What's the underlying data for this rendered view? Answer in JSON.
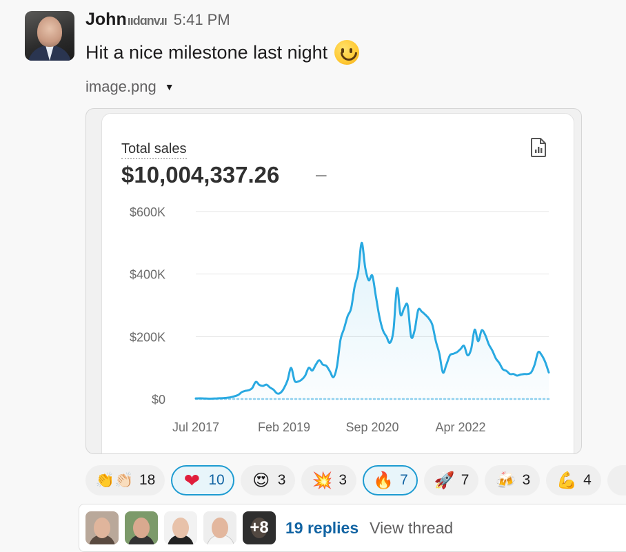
{
  "message": {
    "author": "John",
    "author_obscured": "ııdɑnvɹı",
    "time": "5:41 PM",
    "text": "Hit a nice milestone last night",
    "attachment": {
      "filename": "image.png",
      "caret": "▼"
    }
  },
  "card": {
    "title": "Total sales",
    "value": "$10,004,337.26",
    "dash": "–",
    "icon": "report-icon"
  },
  "chart_data": {
    "type": "area",
    "title": "Total sales",
    "ylim": [
      0,
      600000
    ],
    "yticks": [
      {
        "value": 0,
        "label": "$0"
      },
      {
        "value": 200000,
        "label": "$200K"
      },
      {
        "value": 400000,
        "label": "$400K"
      },
      {
        "value": 600000,
        "label": "$600K"
      }
    ],
    "xlim": [
      0,
      100
    ],
    "xticks": [
      {
        "x": 0,
        "label": "Jul 2017"
      },
      {
        "x": 25,
        "label": "Feb 2019"
      },
      {
        "x": 50,
        "label": "Sep 2020"
      },
      {
        "x": 75,
        "label": "Apr 2022"
      }
    ],
    "line_color": "#29a9e1",
    "comparison_line": "dotted at $0",
    "series": [
      {
        "points": [
          [
            0,
            2000
          ],
          [
            2,
            2000
          ],
          [
            4,
            1000
          ],
          [
            6,
            2000
          ],
          [
            8,
            3000
          ],
          [
            10,
            6000
          ],
          [
            12,
            13000
          ],
          [
            13,
            22000
          ],
          [
            14,
            26000
          ],
          [
            15,
            28000
          ],
          [
            16,
            35000
          ],
          [
            17,
            55000
          ],
          [
            18,
            45000
          ],
          [
            19,
            42000
          ],
          [
            20,
            46000
          ],
          [
            21,
            37000
          ],
          [
            22,
            30000
          ],
          [
            23,
            18000
          ],
          [
            24,
            20000
          ],
          [
            25,
            35000
          ],
          [
            26,
            60000
          ],
          [
            27,
            100000
          ],
          [
            28,
            58000
          ],
          [
            29,
            56000
          ],
          [
            30,
            62000
          ],
          [
            31,
            75000
          ],
          [
            32,
            100000
          ],
          [
            33,
            91000
          ],
          [
            34,
            110000
          ],
          [
            35,
            124000
          ],
          [
            36,
            110000
          ],
          [
            37,
            106000
          ],
          [
            38,
            88000
          ],
          [
            39,
            70000
          ],
          [
            40,
            105000
          ],
          [
            41,
            190000
          ],
          [
            42,
            225000
          ],
          [
            43,
            265000
          ],
          [
            44,
            290000
          ],
          [
            45,
            360000
          ],
          [
            46,
            405000
          ],
          [
            47,
            500000
          ],
          [
            48,
            420000
          ],
          [
            49,
            380000
          ],
          [
            50,
            395000
          ],
          [
            51,
            330000
          ],
          [
            52,
            265000
          ],
          [
            53,
            220000
          ],
          [
            54,
            200000
          ],
          [
            55,
            180000
          ],
          [
            56,
            220000
          ],
          [
            57,
            355000
          ],
          [
            58,
            270000
          ],
          [
            59,
            290000
          ],
          [
            60,
            300000
          ],
          [
            61,
            200000
          ],
          [
            62,
            220000
          ],
          [
            63,
            285000
          ],
          [
            64,
            280000
          ],
          [
            65,
            270000
          ],
          [
            66,
            258000
          ],
          [
            67,
            238000
          ],
          [
            68,
            185000
          ],
          [
            69,
            145000
          ],
          [
            70,
            85000
          ],
          [
            71,
            110000
          ],
          [
            72,
            140000
          ],
          [
            73,
            145000
          ],
          [
            74,
            150000
          ],
          [
            75,
            160000
          ],
          [
            76,
            170000
          ],
          [
            77,
            140000
          ],
          [
            78,
            160000
          ],
          [
            79,
            222000
          ],
          [
            80,
            185000
          ],
          [
            81,
            220000
          ],
          [
            82,
            205000
          ],
          [
            83,
            175000
          ],
          [
            84,
            155000
          ],
          [
            85,
            130000
          ],
          [
            86,
            115000
          ],
          [
            87,
            95000
          ],
          [
            88,
            90000
          ],
          [
            89,
            80000
          ],
          [
            90,
            80000
          ],
          [
            91,
            75000
          ],
          [
            92,
            78000
          ],
          [
            93,
            80000
          ],
          [
            94,
            80000
          ],
          [
            95,
            85000
          ],
          [
            96,
            110000
          ],
          [
            97,
            150000
          ],
          [
            98,
            140000
          ],
          [
            99,
            118000
          ],
          [
            100,
            85000
          ]
        ]
      }
    ]
  },
  "reactions": [
    {
      "emoji": "👏👏🏻",
      "name": "clap-emoji",
      "count": "18",
      "selected": false
    },
    {
      "emoji": "❤",
      "name": "heart-emoji",
      "count": "10",
      "selected": true
    },
    {
      "emoji": "😍",
      "name": "heart-eyes-emoji",
      "count": "3",
      "selected": false
    },
    {
      "emoji": "💥",
      "name": "boom-emoji",
      "count": "3",
      "selected": false
    },
    {
      "emoji": "🔥",
      "name": "fire-emoji",
      "count": "7",
      "selected": true
    },
    {
      "emoji": "🚀",
      "name": "rocket-emoji",
      "count": "7",
      "selected": false
    },
    {
      "emoji": "🍻",
      "name": "beers-emoji",
      "count": "3",
      "selected": false
    },
    {
      "emoji": "💪",
      "name": "muscle-emoji",
      "count": "4",
      "selected": false
    }
  ],
  "thread": {
    "more_count": "+8",
    "replies_label": "19 replies",
    "view_label": "View thread"
  },
  "colors": {
    "accent": "#1264a3",
    "selected_border": "#1d9bd1",
    "chart_line": "#29a9e1"
  }
}
